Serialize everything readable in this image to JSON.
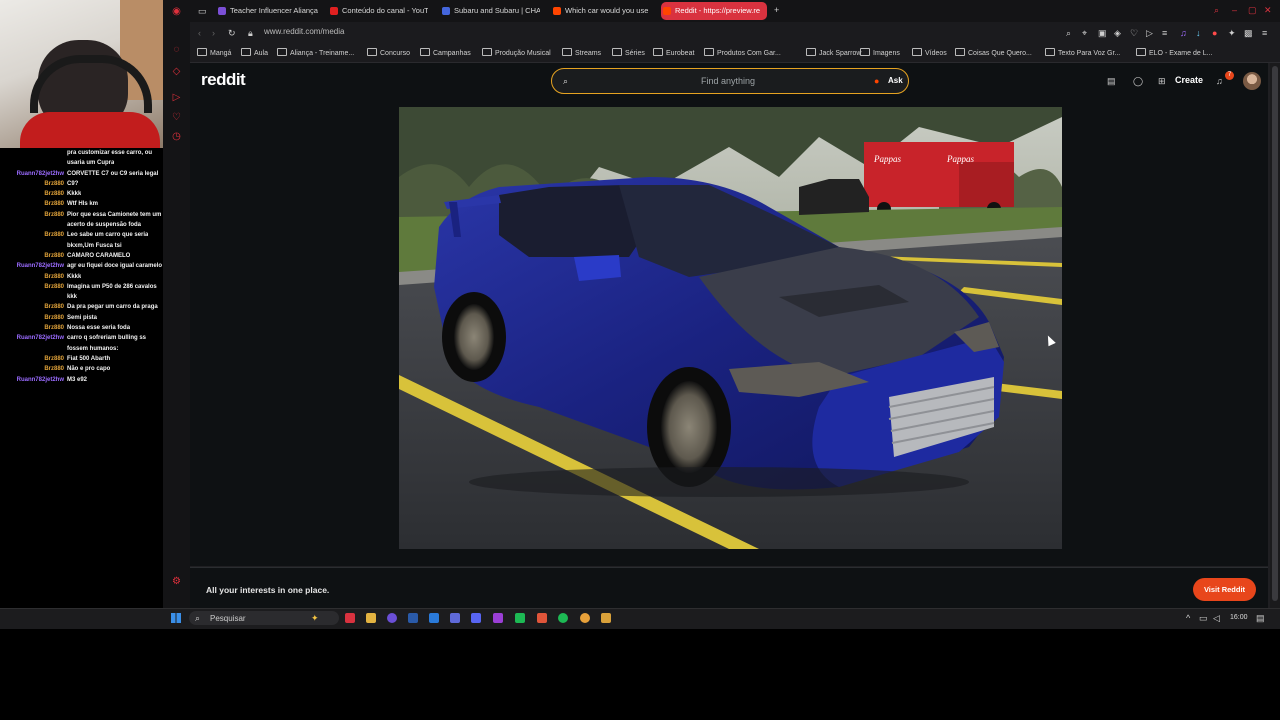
{
  "chat": {
    "messages": [
      {
        "user": "",
        "msg": "pra customizar esse carro, ou",
        "color": "#ffffff"
      },
      {
        "user": "",
        "msg": "usaria um Cupra",
        "color": "#ffffff"
      },
      {
        "user": "Ruann782jet2hw",
        "msg": "CORVETTE C7 ou C9 seria legal",
        "color": "#9a6bff"
      },
      {
        "user": "Brz880",
        "msg": "C9?",
        "color": "#e0a23a"
      },
      {
        "user": "Brz880",
        "msg": "Kkkk",
        "color": "#e0a23a"
      },
      {
        "user": "Brz880",
        "msg": "Wtf Hls km",
        "color": "#e0a23a"
      },
      {
        "user": "Brz880",
        "msg": "Pior que essa Camionete tem um",
        "color": "#e0a23a"
      },
      {
        "user": "",
        "msg": "acerto de suspensão foda",
        "color": "#ffffff"
      },
      {
        "user": "Brz880",
        "msg": "Leo sabe um carro que seria",
        "color": "#e0a23a"
      },
      {
        "user": "",
        "msg": "bkxm,Um Fusca tsi",
        "color": "#ffffff"
      },
      {
        "user": "Brz880",
        "msg": "CAMARO CARAMELO",
        "color": "#e0a23a"
      },
      {
        "user": "Ruann782jet2hw",
        "msg": "agr eu fiquei doce igual caramelo",
        "color": "#9a6bff"
      },
      {
        "user": "Brz880",
        "msg": "Kkkk",
        "color": "#e0a23a"
      },
      {
        "user": "Brz880",
        "msg": "Imagina um P50 de 286 cavalos",
        "color": "#e0a23a"
      },
      {
        "user": "",
        "msg": "kkk",
        "color": "#ffffff"
      },
      {
        "user": "Brz880",
        "msg": "Da pra pegar um carro da praga",
        "color": "#e0a23a"
      },
      {
        "user": "Brz880",
        "msg": "Semi pista",
        "color": "#e0a23a"
      },
      {
        "user": "Brz880",
        "msg": "Nossa esse seria foda",
        "color": "#e0a23a"
      },
      {
        "user": "Ruann782jet2hw",
        "msg": "carro q sofreriam bulling ss",
        "color": "#9a6bff"
      },
      {
        "user": "",
        "msg": "fossem humanos:",
        "color": "#ffffff"
      },
      {
        "user": "Brz880",
        "msg": "Fiat 500 Abarth",
        "color": "#e0a23a"
      },
      {
        "user": "Brz880",
        "msg": "Não e pro capo",
        "color": "#e0a23a"
      },
      {
        "user": "Ruann782jet2hw",
        "msg": "M3 e92",
        "color": "#9a6bff"
      }
    ]
  },
  "browser": {
    "tabs": [
      {
        "label": "Teacher Influencer Aliança",
        "color": "#7b4fd6"
      },
      {
        "label": "Conteúdo do canal - YouT",
        "color": "#e02020"
      },
      {
        "label": "Subaru and Subaru | CHA",
        "color": "#4466dd"
      },
      {
        "label": "Which car would you use",
        "color": "#ff4500"
      },
      {
        "label": "Reddit - https://preview.re",
        "color": "#ff4500"
      }
    ],
    "new_tab_icon": "+",
    "url": "www.reddit.com/media",
    "bookmarks": [
      "Mangá",
      "Aula",
      "Aliança - Treiname...",
      "Concurso",
      "Campanhas",
      "Produção Musical",
      "Streams",
      "Séries",
      "Eurobeat",
      "Produtos Com Gar...",
      "Jack Sparrow",
      "Imagens",
      "Vídeos",
      "Coisas Que Quero...",
      "Texto Para Voz Gr...",
      "ELO - Exame de L..."
    ]
  },
  "reddit": {
    "logo": "reddit",
    "search_placeholder": "Find anything",
    "ask_label": "Ask",
    "create_label": "Create",
    "notification_count": "7",
    "footer_text": "All your interests in one place.",
    "visit_button": "Visit Reddit",
    "accent": "#e8461b"
  },
  "photo": {
    "truck_text": "Pappas"
  },
  "taskbar": {
    "search_placeholder": "Pesquisar",
    "time": "16:00"
  }
}
